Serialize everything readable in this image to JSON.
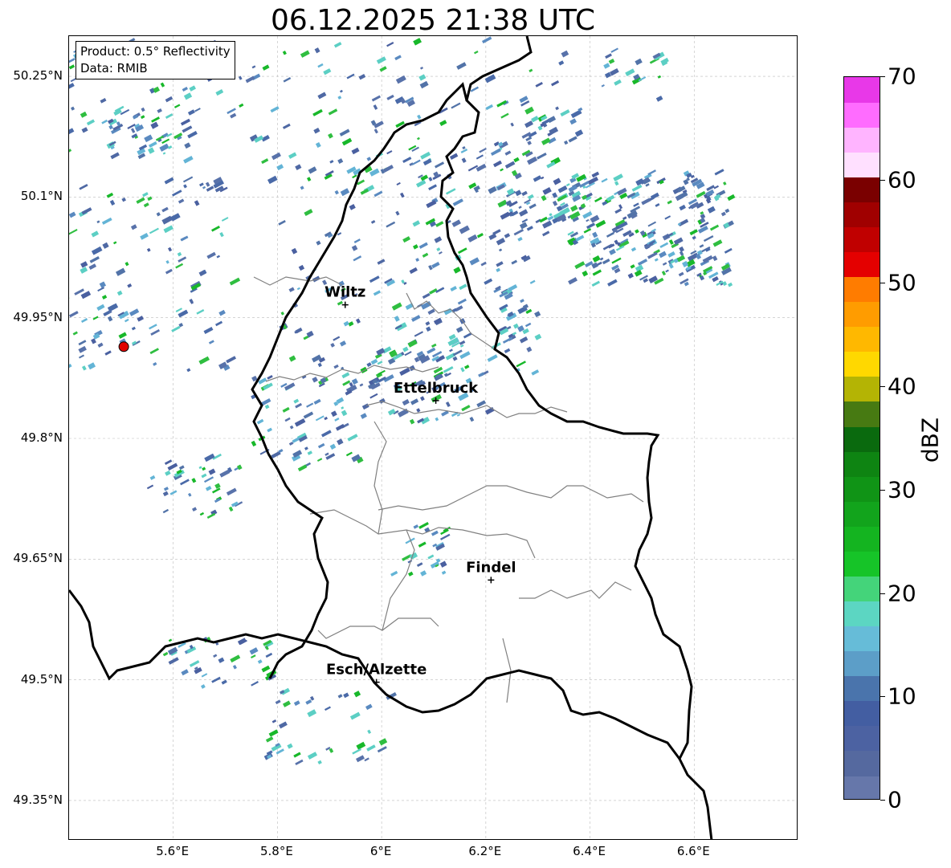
{
  "title": "06.12.2025 21:38 UTC",
  "info": {
    "line1": "Product: 0.5° Reflectivity",
    "line2": "Data: RMIB"
  },
  "map": {
    "lon_range": [
      5.4,
      6.8
    ],
    "lat_range": [
      49.3,
      50.3
    ],
    "lat_ticks": [
      {
        "value": 50.25,
        "label": "50.25°N"
      },
      {
        "value": 50.1,
        "label": "50.1°N"
      },
      {
        "value": 49.95,
        "label": "49.95°N"
      },
      {
        "value": 49.8,
        "label": "49.8°N"
      },
      {
        "value": 49.65,
        "label": "49.65°N"
      },
      {
        "value": 49.5,
        "label": "49.5°N"
      },
      {
        "value": 49.35,
        "label": "49.35°N"
      }
    ],
    "lon_ticks": [
      {
        "value": 5.6,
        "label": "5.6°E"
      },
      {
        "value": 5.8,
        "label": "5.8°E"
      },
      {
        "value": 6.0,
        "label": "6°E"
      },
      {
        "value": 6.2,
        "label": "6.2°E"
      },
      {
        "value": 6.4,
        "label": "6.4°E"
      },
      {
        "value": 6.6,
        "label": "6.6°E"
      }
    ],
    "cities": [
      {
        "name": "Wiltz",
        "lon": 5.93,
        "lat": 49.966
      },
      {
        "name": "Ettelbruck",
        "lon": 6.104,
        "lat": 49.847
      },
      {
        "name": "Findel",
        "lon": 6.21,
        "lat": 49.624
      },
      {
        "name": "Esch/Alzette",
        "lon": 5.99,
        "lat": 49.497
      }
    ],
    "radar_site": {
      "lon": 5.505,
      "lat": 49.914,
      "color": "#e00000"
    },
    "border_color": "#000000",
    "canton_color": "#808080"
  },
  "colorbar": {
    "label": "dBZ",
    "min": 0,
    "max": 70,
    "ticks": [
      {
        "value": 0,
        "label": "0"
      },
      {
        "value": 10,
        "label": "10"
      },
      {
        "value": 20,
        "label": "20"
      },
      {
        "value": 30,
        "label": "30"
      },
      {
        "value": 40,
        "label": "40"
      },
      {
        "value": 50,
        "label": "50"
      },
      {
        "value": 60,
        "label": "60"
      },
      {
        "value": 70,
        "label": "70"
      }
    ],
    "colors": [
      "#6677aa",
      "#55699f",
      "#4c62a2",
      "#435ea2",
      "#4a74ac",
      "#5c9ec8",
      "#66bcd8",
      "#5cd6c2",
      "#44d47a",
      "#16c428",
      "#14b420",
      "#12a41c",
      "#109416",
      "#0e8412",
      "#0a6a0e",
      "#477a12",
      "#b4b404",
      "#ffd800",
      "#ffb800",
      "#ff9c00",
      "#ff7c00",
      "#e40000",
      "#c00000",
      "#a00000",
      "#7a0000",
      "#ffe0ff",
      "#ffb4ff",
      "#ff6cff",
      "#e838e8"
    ]
  },
  "chart_data": {
    "type": "heatmap",
    "title": "06.12.2025 21:38 UTC",
    "xlabel": "",
    "ylabel": "",
    "xlim": [
      5.4,
      6.8
    ],
    "ylim": [
      49.3,
      50.3
    ],
    "colorbar_label": "dBZ",
    "colorbar_range": [
      0,
      70
    ],
    "notes_visible": [
      "Product: 0.5° Reflectivity",
      "Data: RMIB"
    ]
  }
}
